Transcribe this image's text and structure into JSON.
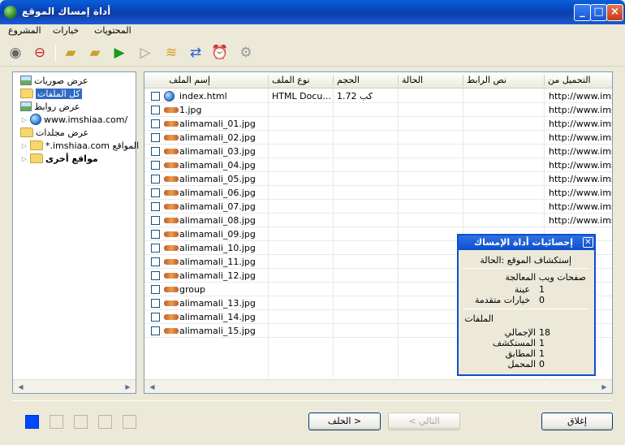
{
  "window": {
    "title": "أداة إمساك الموقع"
  },
  "menu": [
    {
      "label": "المحتويات"
    },
    {
      "label": "خيارات"
    },
    {
      "label": "المشروع"
    }
  ],
  "toolbar_icons": [
    "search-globe-icon",
    "stop-globe-icon",
    "folder-open-icon",
    "folder-save-icon",
    "play-icon",
    "pause-icon",
    "layers-icon",
    "refresh-icon",
    "alarm-clock-icon",
    "settings-icon"
  ],
  "tree": {
    "view_pictures": "عرض صوريات",
    "all_files": "كل الملفات",
    "view_links": "عرض روابط",
    "site_url": "www.imshiaa.com/",
    "view_folders": "عرض مجلدات",
    "site_folder": "*.imshiaa.com المواقع",
    "other_sites": "مواقع أخرى"
  },
  "columns": [
    "إسم الملف",
    "نوع الملف",
    "الحجم",
    "الحالة",
    "نص الرابط",
    "التحميل من"
  ],
  "rows": [
    {
      "name": "index.html",
      "type": "HTML Docu...",
      "size": "كب 1.72",
      "from": "http://www.imsh",
      "icon": "html"
    },
    {
      "name": "1.jpg",
      "type": "",
      "size": "",
      "from": "http://www.imsh",
      "icon": "jpg"
    },
    {
      "name": "alimamali_01.jpg",
      "type": "",
      "size": "",
      "from": "http://www.imsh",
      "icon": "jpg"
    },
    {
      "name": "alimamali_02.jpg",
      "type": "",
      "size": "",
      "from": "http://www.imsh",
      "icon": "jpg"
    },
    {
      "name": "alimamali_03.jpg",
      "type": "",
      "size": "",
      "from": "http://www.imsh",
      "icon": "jpg"
    },
    {
      "name": "alimamali_04.jpg",
      "type": "",
      "size": "",
      "from": "http://www.imsh",
      "icon": "jpg"
    },
    {
      "name": "alimamali_05.jpg",
      "type": "",
      "size": "",
      "from": "http://www.imsh",
      "icon": "jpg"
    },
    {
      "name": "alimamali_06.jpg",
      "type": "",
      "size": "",
      "from": "http://www.imsh",
      "icon": "jpg"
    },
    {
      "name": "alimamali_07.jpg",
      "type": "",
      "size": "",
      "from": "http://www.imsh",
      "icon": "jpg"
    },
    {
      "name": "alimamali_08.jpg",
      "type": "",
      "size": "",
      "from": "http://www.imsh",
      "icon": "jpg"
    },
    {
      "name": "alimamali_09.jpg",
      "type": "",
      "size": "",
      "from": "",
      "icon": "jpg"
    },
    {
      "name": "alimamali_10.jpg",
      "type": "",
      "size": "",
      "from": "",
      "icon": "jpg"
    },
    {
      "name": "alimamali_11.jpg",
      "type": "",
      "size": "",
      "from": "",
      "icon": "jpg"
    },
    {
      "name": "alimamali_12.jpg",
      "type": "",
      "size": "",
      "from": "",
      "icon": "jpg"
    },
    {
      "name": "group",
      "type": "",
      "size": "",
      "from": "",
      "icon": "jpg"
    },
    {
      "name": "alimamali_13.jpg",
      "type": "",
      "size": "",
      "from": "",
      "icon": "jpg"
    },
    {
      "name": "alimamali_14.jpg",
      "type": "",
      "size": "",
      "from": "",
      "icon": "jpg"
    },
    {
      "name": "alimamali_15.jpg",
      "type": "",
      "size": "",
      "from": "",
      "icon": "jpg"
    }
  ],
  "stats": {
    "title": "إحصائيات أداة الإمساك",
    "status": "إستكشاف الموقع :الحالة",
    "pages_heading": "صفحات ويب المعالجة",
    "sample_label": "عينة",
    "sample_value": "1",
    "advanced_label": "خيارات متقدمة",
    "advanced_value": "0",
    "files_heading": "الملفات",
    "total_label": "الإجمالي",
    "total_value": "18",
    "explored_label": "المستكشف",
    "explored_value": "1",
    "matched_label": "المطابق",
    "matched_value": "1",
    "loaded_label": "المحمل",
    "loaded_value": "0"
  },
  "wizard": {
    "steps": 5,
    "current_step": 1,
    "back": "الخلف >",
    "next": "< التالي",
    "close": "إغلاق"
  }
}
